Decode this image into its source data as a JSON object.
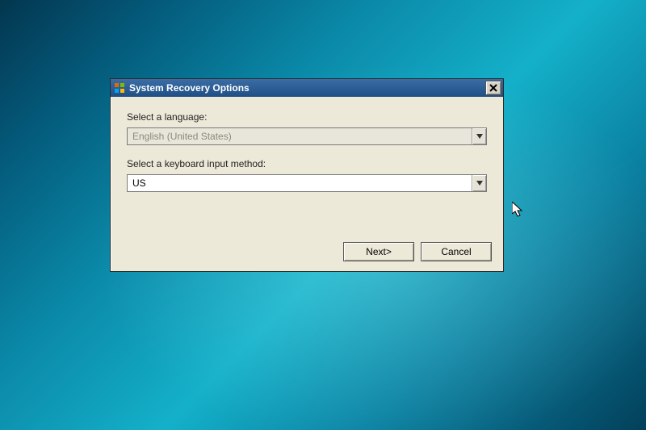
{
  "window": {
    "title": "System Recovery Options"
  },
  "form": {
    "language_label": "Select a language:",
    "language_value": "English (United States)",
    "keyboard_label": "Select a keyboard input method:",
    "keyboard_value": "US"
  },
  "buttons": {
    "next": "Next>",
    "cancel": "Cancel"
  }
}
